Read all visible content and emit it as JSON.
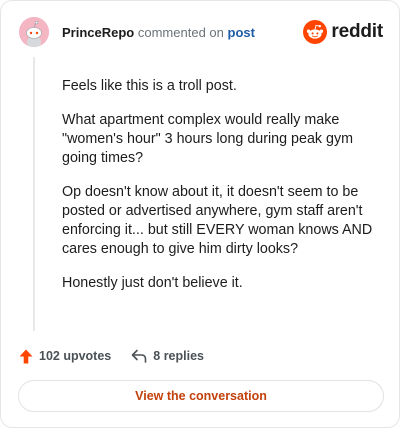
{
  "comment": {
    "author": "PrinceRepo",
    "action_text": "commented on",
    "target_link": "post",
    "paragraphs": [
      "Feels like this is a troll post.",
      "What apartment complex would really make \"women's hour\" 3 hours long during peak gym going times?",
      "Op doesn't know about it, it doesn't seem to be posted or advertised anywhere, gym staff aren't enforcing it... but still EVERY woman knows AND cares enough to give him dirty looks?",
      "Honestly just don't believe it."
    ],
    "upvotes_label": "102 upvotes",
    "replies_label": "8 replies"
  },
  "brand": {
    "wordmark": "reddit",
    "icon": "reddit-snoo-icon",
    "color": "#ff4500"
  },
  "avatar": {
    "icon": "snoo-avatar-icon",
    "background": "#f4b6c2"
  },
  "icons": {
    "upvote": "upvote-arrow-icon",
    "reply": "reply-arrow-icon"
  },
  "colors": {
    "upvote": "#ff4500",
    "link": "#1f5ca8",
    "cta_text": "#c2410c"
  },
  "cta": {
    "label": "View the conversation"
  }
}
